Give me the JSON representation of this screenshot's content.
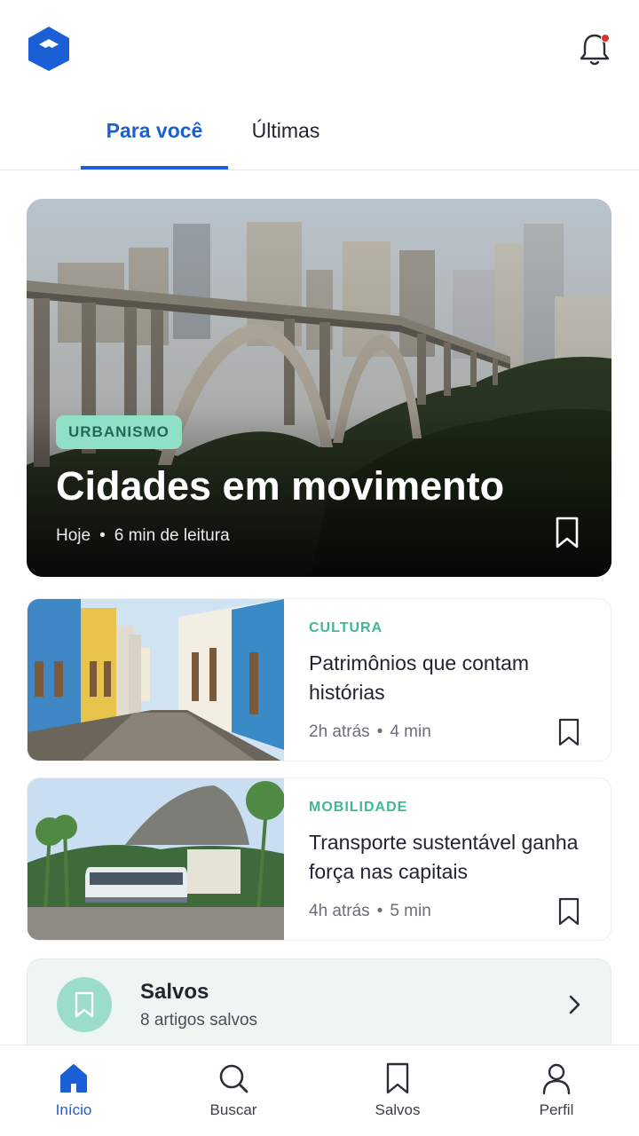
{
  "tabs": {
    "active": "Para você",
    "inactive": "Últimas"
  },
  "hero": {
    "category": "URBANISMO",
    "title": "Cidades em movimento",
    "time": "Hoje",
    "read_time": "6 min de leitura"
  },
  "articles": [
    {
      "category": "CULTURA",
      "title": "Patrimônios que contam histórias",
      "time": "2h atrás",
      "read_time": "4 min"
    },
    {
      "category": "MOBILIDADE",
      "title": "Transporte sustentável ganha força nas capitais",
      "time": "4h atrás",
      "read_time": "5 min"
    }
  ],
  "saved": {
    "title": "Salvos",
    "subtitle": "8 artigos salvos"
  },
  "nav": {
    "home": "Início",
    "search": "Buscar",
    "saved": "Salvos",
    "profile": "Perfil"
  },
  "colors": {
    "accent": "#1b5fd6",
    "category": "#3fb797",
    "notification_dot": "#e0322e"
  },
  "icons": {
    "logo": "hexagon-logo",
    "notification": "bell-icon",
    "bookmark": "bookmark-icon",
    "chevron": "chevron-right-icon",
    "home": "home-icon",
    "search": "search-icon",
    "profile": "user-icon"
  }
}
